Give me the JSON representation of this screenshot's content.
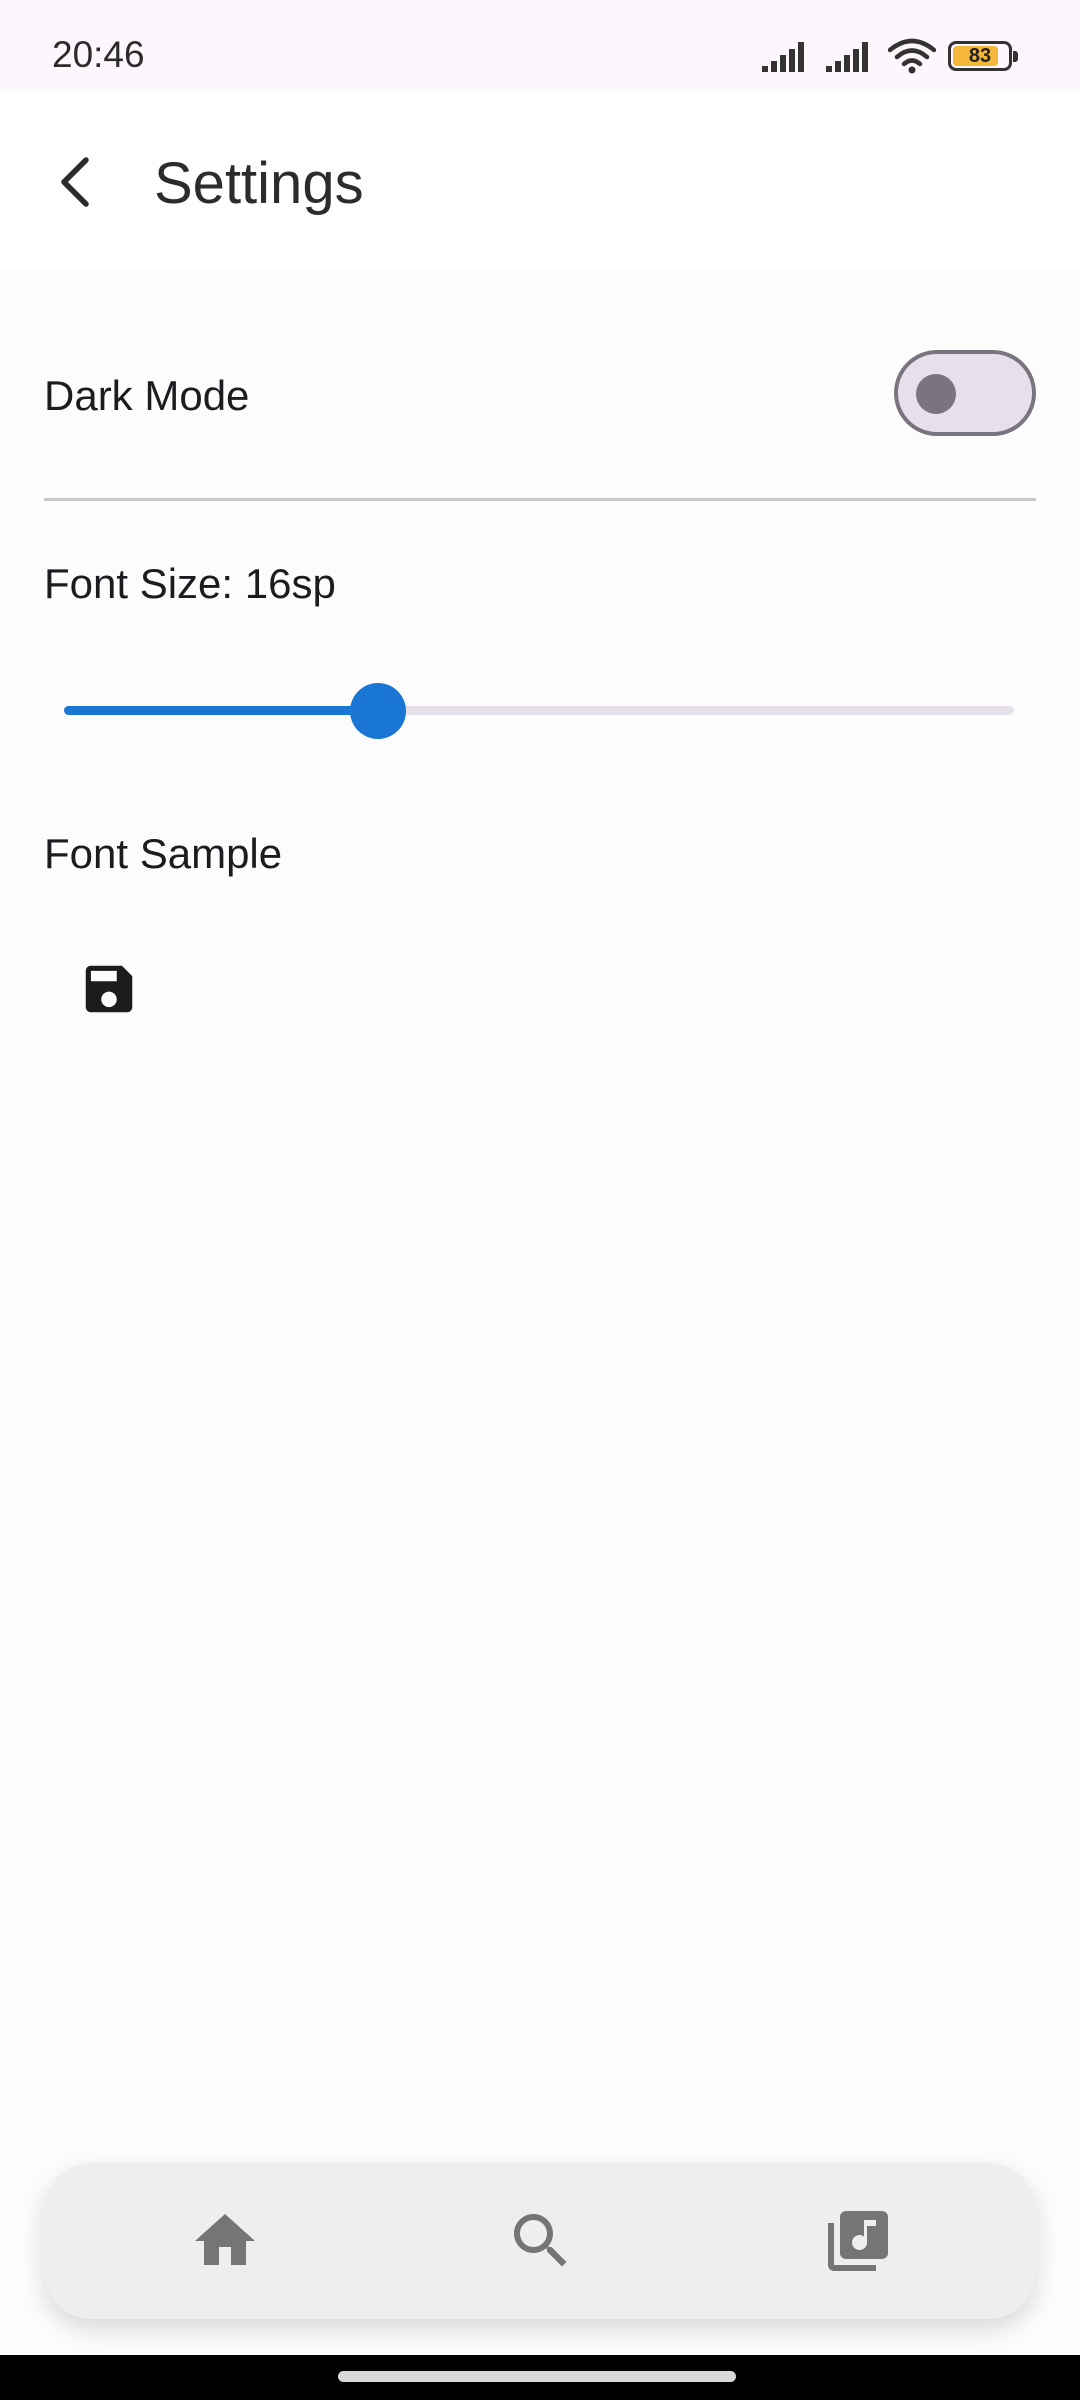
{
  "status_bar": {
    "time": "20:46",
    "battery": "83",
    "icons": [
      "signal-icon",
      "signal-icon",
      "wifi-icon",
      "battery-icon"
    ]
  },
  "app_bar": {
    "title": "Settings",
    "back_icon": "arrow-back-icon"
  },
  "settings": {
    "dark_mode_label": "Dark Mode",
    "dark_mode_on": false,
    "font_size_label": "Font Size: 16sp",
    "font_size_slider_fraction": 0.33,
    "font_sample_label": "Font Sample",
    "save_icon": "save-icon"
  },
  "bottom_nav": {
    "items": [
      {
        "icon": "home-icon"
      },
      {
        "icon": "search-icon"
      },
      {
        "icon": "library-music-icon"
      }
    ]
  },
  "colors": {
    "accent": "#1976d2",
    "switch_off_track": "#e7e0ec",
    "switch_outline": "#79747e",
    "battery": "#f4b73a",
    "nav_background": "#eeeeee"
  }
}
